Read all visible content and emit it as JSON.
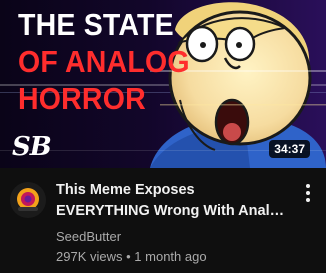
{
  "thumbnail": {
    "title_line1": "THE STATE",
    "title_line2": "OF ANALOG",
    "title_line3": "HORROR",
    "channel_mark": "SB",
    "duration": "34:37",
    "colors": {
      "title_white": "#ffffff",
      "title_red": "#ff2d2d",
      "frame_purple": "#2a0f5a"
    }
  },
  "video": {
    "title_line1": "This Meme Exposes",
    "title_line2": "EVERYTHING Wrong With Anal…",
    "channel": "SeedButter",
    "views": "297K views",
    "separator": "•",
    "age": "1 month ago"
  },
  "icons": {
    "more": "vertical-dots-icon",
    "avatar": "channel-avatar"
  }
}
